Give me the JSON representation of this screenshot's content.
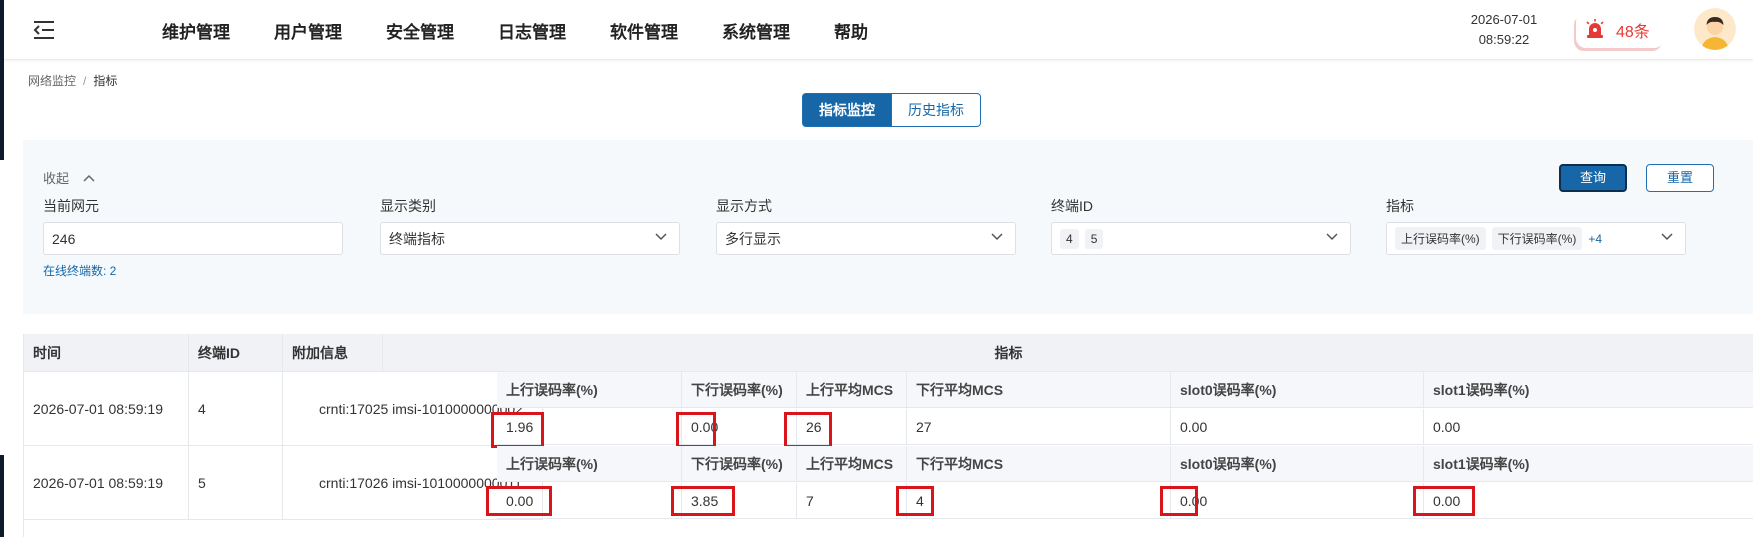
{
  "header": {
    "nav": [
      "维护管理",
      "用户管理",
      "安全管理",
      "日志管理",
      "软件管理",
      "系统管理",
      "帮助"
    ],
    "date": "2026-07-01",
    "time": "08:59:22",
    "alarm_count": "48条"
  },
  "breadcrumb": {
    "parent": "网络监控",
    "current": "指标",
    "separator": "/"
  },
  "tabs": {
    "active": "指标监控",
    "inactive": "历史指标"
  },
  "filter": {
    "collapse_label": "收起",
    "query_label": "查询",
    "reset_label": "重置",
    "fields": {
      "ne": {
        "label": "当前网元",
        "value": "246"
      },
      "category": {
        "label": "显示类别",
        "value": "终端指标"
      },
      "mode": {
        "label": "显示方式",
        "value": "多行显示"
      },
      "terminal": {
        "label": "终端ID",
        "chips": [
          "4",
          "5"
        ]
      },
      "metric": {
        "label": "指标",
        "chips": [
          "上行误码率(%)",
          "下行误码率(%)"
        ],
        "more": "+4"
      }
    },
    "online_text": "在线终端数: 2"
  },
  "table": {
    "columns": {
      "time": "时间",
      "terminal": "终端ID",
      "extra": "附加信息",
      "metrics": "指标"
    },
    "metric_headers": [
      "上行误码率(%)",
      "下行误码率(%)",
      "上行平均MCS",
      "下行平均MCS",
      "slot0误码率(%)",
      "slot1误码率(%)"
    ],
    "rows": [
      {
        "time": "2026-07-01 08:59:19",
        "terminal": "4",
        "extra": "crnti:17025 imsi-1010000000002",
        "values": [
          "1.96",
          "0.00",
          "26",
          "27",
          "0.00",
          "0.00"
        ],
        "highlighted": [
          0,
          1,
          2
        ]
      },
      {
        "time": "2026-07-01 08:59:19",
        "terminal": "5",
        "extra": "crnti:17026 imsi-1010000000011",
        "values": [
          "0.00",
          "3.85",
          "7",
          "4",
          "0.00",
          "0.00"
        ],
        "highlighted": [
          0,
          1,
          3,
          4,
          5
        ]
      }
    ]
  },
  "colors": {
    "primary": "#1767a8",
    "highlight": "#d9141b",
    "alarm": "#e53935"
  },
  "icons": {
    "menu": "menu-fold-icon",
    "alarm": "siren-icon",
    "avatar": "user-avatar-icon",
    "chevron": "chevron-down-icon",
    "collapse": "chevron-up-icon"
  }
}
